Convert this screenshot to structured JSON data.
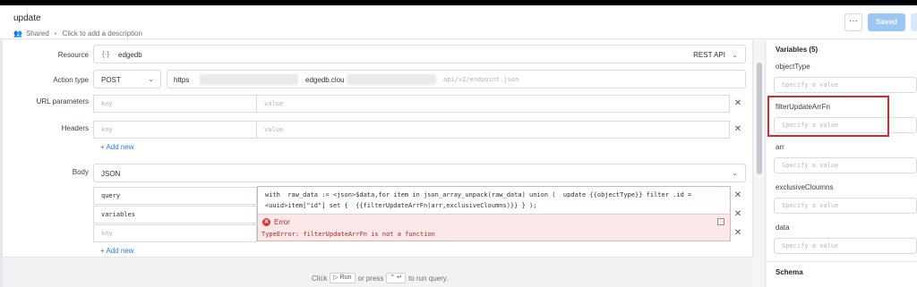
{
  "header": {
    "title": "update",
    "shared_label": "Shared",
    "description_placeholder": "Click to add a description",
    "more_label": "···",
    "saved_label": "Saved"
  },
  "form": {
    "resource": {
      "label": "Resource",
      "value": "edgedb",
      "type": "REST API",
      "icon": "braces-icon"
    },
    "action_type": {
      "label": "Action type",
      "method": "POST",
      "url_prefix": "https",
      "url_mid": "edgedb.clou",
      "url_path": "api/v2/endpoint.json"
    },
    "url_params": {
      "label": "URL parameters",
      "key_placeholder": "key",
      "value_placeholder": "value"
    },
    "headers": {
      "label": "Headers",
      "key_placeholder": "key",
      "value_placeholder": "value",
      "add_new": "+ Add new"
    },
    "body": {
      "label": "Body",
      "format": "JSON",
      "rows": [
        "query",
        "variables"
      ],
      "key_placeholder": "key",
      "add_new": "+ Add new"
    }
  },
  "popover": {
    "code_line1": "with  raw_data := <json>$data,for item in json_array_unpack(raw_data) union (  update {{objectType}} filter .id =",
    "code_line2": "<uuid>item[\"id\"] set {  {{filterUpdateArrFn(arr,exclusiveCloumns)}} } );",
    "error_title": "Error",
    "error_message": "TypeError: filterUpdateArrFn is not a function"
  },
  "footer": {
    "click": "Click",
    "run": "Run",
    "or_press": "or press",
    "keys": "⌃ ↵",
    "to_run": "to run query."
  },
  "sidebar": {
    "title": "Variables (5)",
    "variables": [
      {
        "name": "objectType",
        "placeholder": "Specify a value"
      },
      {
        "name": "filterUpdateArrFn",
        "placeholder": "Specify a value"
      },
      {
        "name": "arr",
        "placeholder": "Specify a value"
      },
      {
        "name": "exclusiveCloumns",
        "placeholder": "Specify a value"
      },
      {
        "name": "data",
        "placeholder": "Specify a value"
      }
    ],
    "schema_label": "Schema"
  },
  "colors": {
    "accent": "#2b7de9",
    "saved_button": "#9cc6f5",
    "error": "#c0262b",
    "highlight": "#e0262a"
  }
}
